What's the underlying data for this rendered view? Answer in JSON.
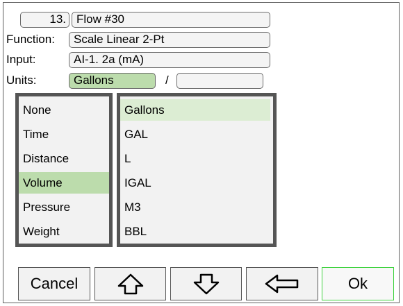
{
  "header": {
    "channel_number": "13.",
    "channel_name": "Flow #30"
  },
  "fields": {
    "function_label": "Function:",
    "function_value": "Scale Linear 2-Pt",
    "input_label": "Input:",
    "input_value": "AI-1. 2a (mA)",
    "units_label": "Units:",
    "units_value": "Gallons",
    "units_separator": "/",
    "units_per_value": ""
  },
  "categories": {
    "items": [
      "None",
      "Time",
      "Distance",
      "Volume",
      "Pressure",
      "Weight"
    ],
    "selected": "Volume"
  },
  "units_list": {
    "items": [
      "Gallons",
      "GAL",
      "L",
      "IGAL",
      "M3",
      "BBL"
    ],
    "selected": "Gallons"
  },
  "buttons": {
    "cancel": "Cancel",
    "ok": "Ok",
    "up_icon": "arrow-up-icon",
    "down_icon": "arrow-down-icon",
    "back_icon": "arrow-left-icon"
  },
  "colors": {
    "selected_green": "#bcdcac",
    "highlight_green": "#dcedd3",
    "ok_border": "#3fd23f",
    "panel_border": "#555555"
  }
}
